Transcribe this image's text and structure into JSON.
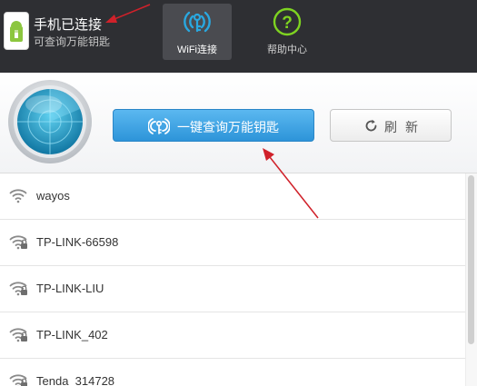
{
  "header": {
    "phone_status": {
      "title": "手机已连接",
      "subtitle": "可查询万能钥匙",
      "icon": "android-phone-icon"
    },
    "tabs": [
      {
        "label": "WiFi连接",
        "icon": "wifi-key-icon",
        "active": true
      },
      {
        "label": "帮助中心",
        "icon": "question-circle-icon",
        "active": false
      }
    ]
  },
  "actions": {
    "query_button": {
      "label": "一键查询万能钥匙",
      "icon": "wifi-key-icon"
    },
    "refresh_button": {
      "label": "刷新",
      "icon": "refresh-icon"
    }
  },
  "networks": [
    {
      "ssid": "wayos",
      "locked": false
    },
    {
      "ssid": "TP-LINK-66598",
      "locked": true
    },
    {
      "ssid": "TP-LINK-LIU",
      "locked": true
    },
    {
      "ssid": "TP-LINK_402",
      "locked": true
    },
    {
      "ssid": "Tenda_314728",
      "locked": true
    }
  ],
  "colors": {
    "header_bg": "#2e2f33",
    "accent_blue": "#2d94d9",
    "tab_green": "#7ed321",
    "annotation_red": "#d0212a"
  }
}
